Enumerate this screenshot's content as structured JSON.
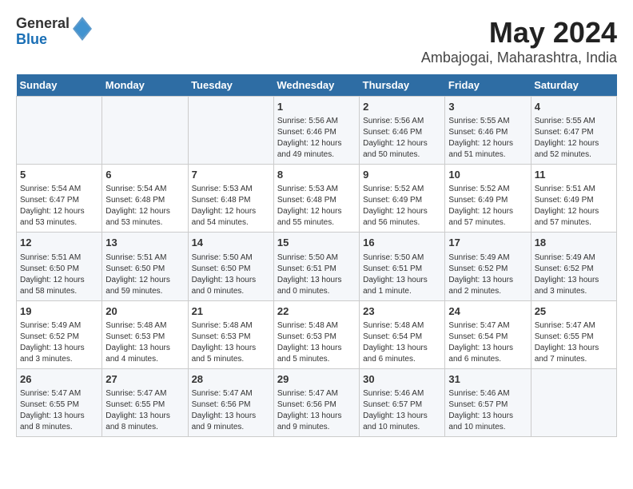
{
  "logo": {
    "general": "General",
    "blue": "Blue"
  },
  "title": "May 2024",
  "subtitle": "Ambajogai, Maharashtra, India",
  "headers": [
    "Sunday",
    "Monday",
    "Tuesday",
    "Wednesday",
    "Thursday",
    "Friday",
    "Saturday"
  ],
  "weeks": [
    [
      {
        "day": "",
        "info": ""
      },
      {
        "day": "",
        "info": ""
      },
      {
        "day": "",
        "info": ""
      },
      {
        "day": "1",
        "info": "Sunrise: 5:56 AM\nSunset: 6:46 PM\nDaylight: 12 hours\nand 49 minutes."
      },
      {
        "day": "2",
        "info": "Sunrise: 5:56 AM\nSunset: 6:46 PM\nDaylight: 12 hours\nand 50 minutes."
      },
      {
        "day": "3",
        "info": "Sunrise: 5:55 AM\nSunset: 6:46 PM\nDaylight: 12 hours\nand 51 minutes."
      },
      {
        "day": "4",
        "info": "Sunrise: 5:55 AM\nSunset: 6:47 PM\nDaylight: 12 hours\nand 52 minutes."
      }
    ],
    [
      {
        "day": "5",
        "info": "Sunrise: 5:54 AM\nSunset: 6:47 PM\nDaylight: 12 hours\nand 53 minutes."
      },
      {
        "day": "6",
        "info": "Sunrise: 5:54 AM\nSunset: 6:48 PM\nDaylight: 12 hours\nand 53 minutes."
      },
      {
        "day": "7",
        "info": "Sunrise: 5:53 AM\nSunset: 6:48 PM\nDaylight: 12 hours\nand 54 minutes."
      },
      {
        "day": "8",
        "info": "Sunrise: 5:53 AM\nSunset: 6:48 PM\nDaylight: 12 hours\nand 55 minutes."
      },
      {
        "day": "9",
        "info": "Sunrise: 5:52 AM\nSunset: 6:49 PM\nDaylight: 12 hours\nand 56 minutes."
      },
      {
        "day": "10",
        "info": "Sunrise: 5:52 AM\nSunset: 6:49 PM\nDaylight: 12 hours\nand 57 minutes."
      },
      {
        "day": "11",
        "info": "Sunrise: 5:51 AM\nSunset: 6:49 PM\nDaylight: 12 hours\nand 57 minutes."
      }
    ],
    [
      {
        "day": "12",
        "info": "Sunrise: 5:51 AM\nSunset: 6:50 PM\nDaylight: 12 hours\nand 58 minutes."
      },
      {
        "day": "13",
        "info": "Sunrise: 5:51 AM\nSunset: 6:50 PM\nDaylight: 12 hours\nand 59 minutes."
      },
      {
        "day": "14",
        "info": "Sunrise: 5:50 AM\nSunset: 6:50 PM\nDaylight: 13 hours\nand 0 minutes."
      },
      {
        "day": "15",
        "info": "Sunrise: 5:50 AM\nSunset: 6:51 PM\nDaylight: 13 hours\nand 0 minutes."
      },
      {
        "day": "16",
        "info": "Sunrise: 5:50 AM\nSunset: 6:51 PM\nDaylight: 13 hours\nand 1 minute."
      },
      {
        "day": "17",
        "info": "Sunrise: 5:49 AM\nSunset: 6:52 PM\nDaylight: 13 hours\nand 2 minutes."
      },
      {
        "day": "18",
        "info": "Sunrise: 5:49 AM\nSunset: 6:52 PM\nDaylight: 13 hours\nand 3 minutes."
      }
    ],
    [
      {
        "day": "19",
        "info": "Sunrise: 5:49 AM\nSunset: 6:52 PM\nDaylight: 13 hours\nand 3 minutes."
      },
      {
        "day": "20",
        "info": "Sunrise: 5:48 AM\nSunset: 6:53 PM\nDaylight: 13 hours\nand 4 minutes."
      },
      {
        "day": "21",
        "info": "Sunrise: 5:48 AM\nSunset: 6:53 PM\nDaylight: 13 hours\nand 5 minutes."
      },
      {
        "day": "22",
        "info": "Sunrise: 5:48 AM\nSunset: 6:53 PM\nDaylight: 13 hours\nand 5 minutes."
      },
      {
        "day": "23",
        "info": "Sunrise: 5:48 AM\nSunset: 6:54 PM\nDaylight: 13 hours\nand 6 minutes."
      },
      {
        "day": "24",
        "info": "Sunrise: 5:47 AM\nSunset: 6:54 PM\nDaylight: 13 hours\nand 6 minutes."
      },
      {
        "day": "25",
        "info": "Sunrise: 5:47 AM\nSunset: 6:55 PM\nDaylight: 13 hours\nand 7 minutes."
      }
    ],
    [
      {
        "day": "26",
        "info": "Sunrise: 5:47 AM\nSunset: 6:55 PM\nDaylight: 13 hours\nand 8 minutes."
      },
      {
        "day": "27",
        "info": "Sunrise: 5:47 AM\nSunset: 6:55 PM\nDaylight: 13 hours\nand 8 minutes."
      },
      {
        "day": "28",
        "info": "Sunrise: 5:47 AM\nSunset: 6:56 PM\nDaylight: 13 hours\nand 9 minutes."
      },
      {
        "day": "29",
        "info": "Sunrise: 5:47 AM\nSunset: 6:56 PM\nDaylight: 13 hours\nand 9 minutes."
      },
      {
        "day": "30",
        "info": "Sunrise: 5:46 AM\nSunset: 6:57 PM\nDaylight: 13 hours\nand 10 minutes."
      },
      {
        "day": "31",
        "info": "Sunrise: 5:46 AM\nSunset: 6:57 PM\nDaylight: 13 hours\nand 10 minutes."
      },
      {
        "day": "",
        "info": ""
      }
    ]
  ]
}
